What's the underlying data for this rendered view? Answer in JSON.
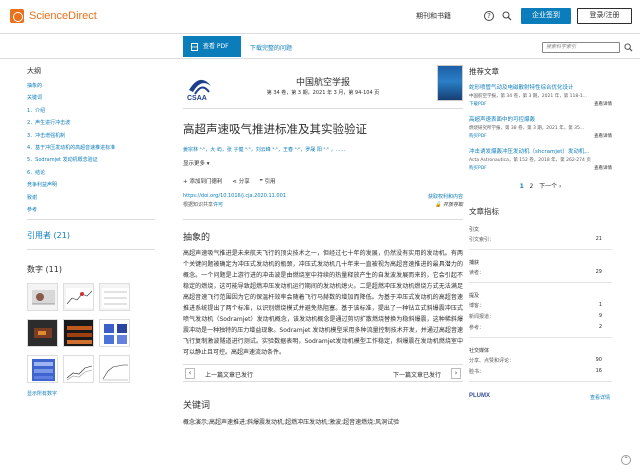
{
  "header": {
    "brand": "ScienceDirect",
    "journals_label": "期刊和书籍",
    "help_label": "?",
    "signin_label": "企业签到",
    "register_label": "登录/注册"
  },
  "toolbar": {
    "pdf_label": "查看 PDF",
    "full_issue_label": "下载完整的问题",
    "search_placeholder": "搜索科学索引"
  },
  "outline": {
    "title": "大纲",
    "items": [
      "抽象的",
      "关键词",
      "1．介绍",
      "2．声生进行冲击波",
      "3．冲击增强机制",
      "4．基于冲压发动机的高超音速推进标准",
      "5．Sodramjet 发动机概念验证",
      "6．结论",
      "竞争利益声明",
      "致谢",
      "参考"
    ]
  },
  "cited_by": "引用者 (21)",
  "figures": {
    "title": "数字 (11)",
    "show_all": "显示所有数字"
  },
  "journal": {
    "logo_text": "CSAA",
    "name": "中国航空学报",
    "meta_prefix": "第 34 卷，第 3 期，2021 年 3 月，第 94-104 页"
  },
  "article": {
    "title": "高超声速吸气推进标准及其实验验证",
    "authors": "姜宗林 ᵃ·ᵇ，大 屿，张 子健 ᵃ·ᵇ，刘云峰 ᵃ·ᵇ，王春 ᵃ·ᵇ，罗晟 阳 ᵃ·ᵇ ，......",
    "show_more": "显示更多",
    "actions": {
      "add_label": "添加到门德利",
      "share_label": "分享",
      "cite_label": "引用"
    },
    "doi": "https://doi.org/10.1016/j.cja.2020.11.001",
    "license_prefix": "根据知识共享",
    "license_link": "许可",
    "rights": "获取权利和内容",
    "open_archive": "开放存取"
  },
  "abstract": {
    "title": "抽象的",
    "text": "高超声速吸气推进是未来航天飞行的顶尖技术之一，但经过七十年的发展，仍然没有实用的发动机。有两个关键问题被确定为冲压式发动机的瓶颈，冲压式发动机几十年来一直被视为高超音速推进的最具潜力的概念。一个问题是上游行进的冲击波是由燃烧室中持续的热量释放产生的自发波发展而来的，它会引起不稳定的燃烧，这可能导致超燃冲压发动机运行期间的发动机熄火。二是超燃冲压发动机燃烧方式无法满足高超音速飞行范围因为它的保温杆效率会随着飞行马赫数的增加而降低。为基于冲压式发动机的高超音速推进系统提出了两个标准，以识别燃烧模式并避免热阻塞。基于该标准，提出了一种钻立式斜爆震冲压式喷气发动机（Sodramjet）发动机概念，该发动机概念是通过剪切扩散燃烧替换为稳斜爆震，这种稀斜爆震冲动是一种独特的压力增益现象。Sodramjet 发动机模型采用多种流量控制技术开发，并通过高超音速飞行复制激波隧道进行测试。实验数据表明，Sodramjet发动机模型工作稳定，斜爆震在发动机燃烧室中可以静止且可控。高超声速流动条件。"
  },
  "pager": {
    "prev_label": "上一篇文章已发行",
    "next_label": "下一篇文章已发行"
  },
  "keywords": {
    "title": "关键词",
    "text": "概念演示;高超声速推进;斜爆震发动机;超燃冲压发动机;激波;超音速燃烧;风洞试验"
  },
  "recommended": {
    "title": "推荐文章",
    "items": [
      {
        "title": "蛇形喷管气动及电磁散射特性综合优化设计",
        "meta": "中国航空学报，第 34 卷，第 3 期，2021 年，第 118-1...",
        "pdf_label": "下载PDF",
        "details_label": "查看详情"
      },
      {
        "title": "高超声速表面中的可控爆轰",
        "meta": "燃烧研究所学报，第 38 卷，第 3 期，2021 年，第 35...",
        "pdf_label": "购买PDF",
        "details_label": "查看详情"
      },
      {
        "title": "冲击诱发爆轰冲压发动机（shcramjet）发动机...",
        "meta": "Acta Astronautica，第 152 卷，2018 年，第 262-274 页",
        "pdf_label": "购买PDF",
        "details_label": "查看详情"
      }
    ],
    "pages": [
      "1",
      "2"
    ],
    "next_label": "下一个"
  },
  "metrics": {
    "title": "文章指标",
    "citations": {
      "label": "引文",
      "rows": [
        {
          "label": "引文索引：",
          "value": "21"
        }
      ]
    },
    "captures": {
      "label": "捕获",
      "rows": [
        {
          "label": "读者：",
          "value": "29"
        }
      ]
    },
    "mentions": {
      "label": "提及",
      "rows": [
        {
          "label": "博客：",
          "value": "1"
        },
        {
          "label": "新闻报道：",
          "value": "9"
        },
        {
          "label": "参考：",
          "value": "2"
        }
      ]
    },
    "social": {
      "label": "社交媒体",
      "rows": [
        {
          "label": "分享、点赞和评论：",
          "value": "90"
        },
        {
          "label": "脸书：",
          "value": "16"
        }
      ]
    },
    "plumx": "PLUMX",
    "plumx_details": "查看详情"
  }
}
